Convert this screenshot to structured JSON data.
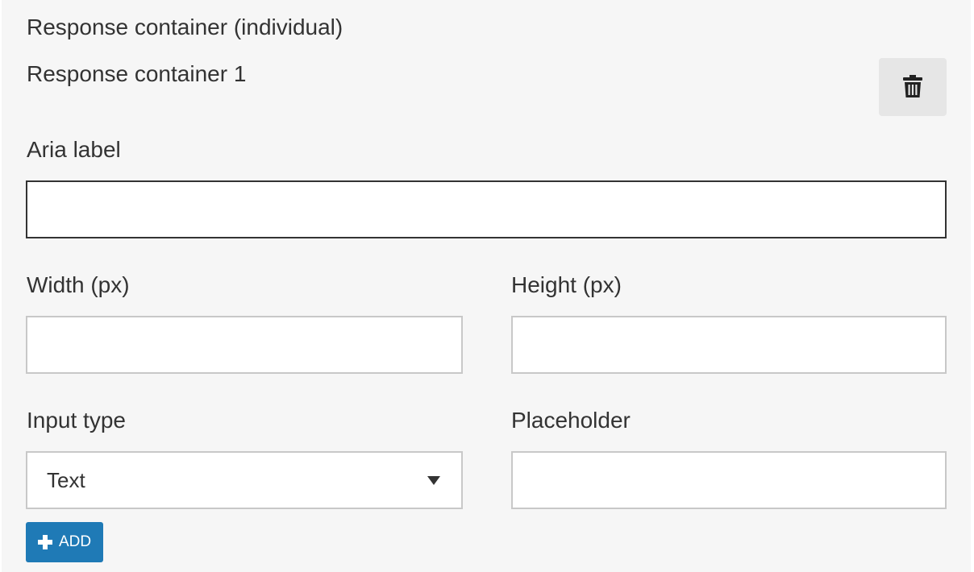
{
  "section": {
    "title": "Response container (individual)",
    "container_name": "Response container 1",
    "delete_icon": "trash-icon"
  },
  "fields": {
    "aria_label": {
      "label": "Aria label",
      "value": "",
      "placeholder": ""
    },
    "width": {
      "label": "Width (px)",
      "value": "",
      "placeholder": ""
    },
    "height": {
      "label": "Height (px)",
      "value": "",
      "placeholder": ""
    },
    "input_type": {
      "label": "Input type",
      "selected": "Text"
    },
    "placeholder": {
      "label": "Placeholder",
      "value": "",
      "placeholder": ""
    }
  },
  "actions": {
    "add_label": "ADD",
    "add_icon": "plus-icon"
  },
  "colors": {
    "panel_bg": "#f6f6f6",
    "accent": "#1f7ab6",
    "delete_bg": "#e6e6e6",
    "input_border": "#c8c8c8",
    "focused_border": "#333333"
  }
}
